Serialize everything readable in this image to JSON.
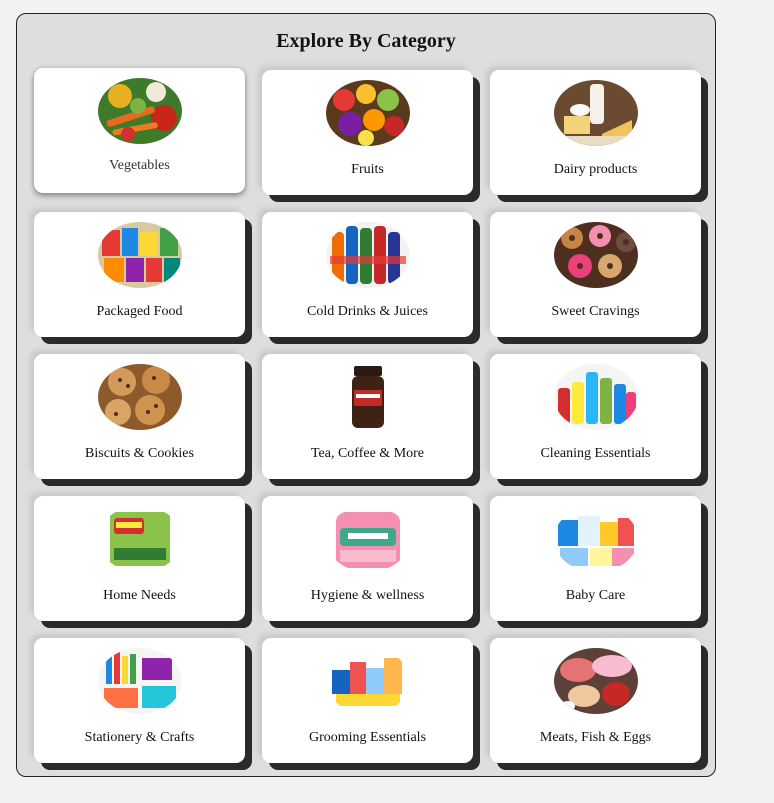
{
  "title": "Explore By Category",
  "categories": [
    {
      "label": "Vegetables",
      "icon": "vegetables-image",
      "state": "hovered"
    },
    {
      "label": "Fruits",
      "icon": "fruits-image"
    },
    {
      "label": "Dairy products",
      "icon": "dairy-image"
    },
    {
      "label": "Packaged Food",
      "icon": "packaged-food-image"
    },
    {
      "label": "Cold Drinks & Juices",
      "icon": "cold-drinks-image"
    },
    {
      "label": "Sweet Cravings",
      "icon": "donuts-image"
    },
    {
      "label": "Biscuits & Cookies",
      "icon": "cookies-image"
    },
    {
      "label": "Tea, Coffee & More",
      "icon": "coffee-jar-image"
    },
    {
      "label": "Cleaning Essentials",
      "icon": "cleaning-products-image"
    },
    {
      "label": "Home Needs",
      "icon": "scrub-pad-image"
    },
    {
      "label": "Hygiene & wellness",
      "icon": "hygiene-pack-image"
    },
    {
      "label": "Baby Care",
      "icon": "baby-care-image"
    },
    {
      "label": "Stationery & Crafts",
      "icon": "stationery-image"
    },
    {
      "label": "Grooming Essentials",
      "icon": "grooming-image"
    },
    {
      "label": "Meats, Fish & Eggs",
      "icon": "meat-fish-image"
    }
  ]
}
